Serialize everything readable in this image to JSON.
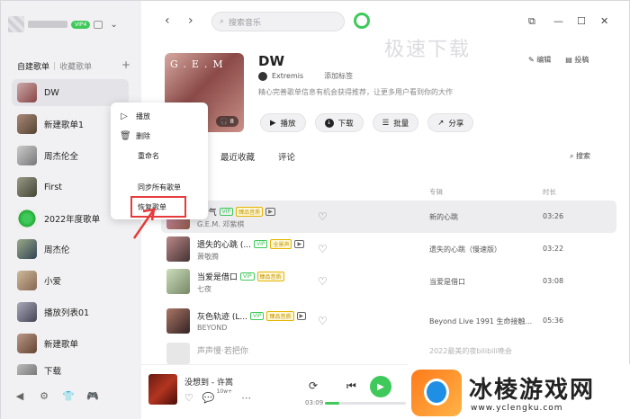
{
  "sidebar": {
    "vip_badge": "VIP4",
    "tab_created": "自建歌单",
    "tab_separator": "|",
    "tab_collected": "收藏歌单",
    "add_symbol": "+",
    "items": [
      {
        "label": "DW"
      },
      {
        "label": "新建歌单1"
      },
      {
        "label": "周杰伦全"
      },
      {
        "label": "First"
      },
      {
        "label": "2022年度歌单"
      },
      {
        "label": "周杰伦"
      },
      {
        "label": "小爱"
      },
      {
        "label": "播放列表01"
      },
      {
        "label": "新建歌单"
      },
      {
        "label": "下载"
      }
    ]
  },
  "topbar": {
    "search_placeholder": "搜索音乐"
  },
  "watermark": "极速下载",
  "playlist": {
    "title": "DW",
    "cover_text": "G.E.M",
    "cover_count": "8",
    "owner": "Extremis",
    "add_tag": "添加标签",
    "description": "精心完善歌单信息有机会获得推荐，让更多用户看到你的大作",
    "edit_label": "编辑",
    "submit_label": "投稿"
  },
  "actions": {
    "play": "播放",
    "download": "下载",
    "batch": "批量",
    "share": "分享"
  },
  "tabs": {
    "recent": "最近收藏",
    "comments": "评论",
    "search": "搜索"
  },
  "columns": {
    "album": "专辑",
    "duration": "时长"
  },
  "songs": [
    {
      "title": "...气",
      "artist": "G.E.M. 邓紫棋",
      "vip": "VIP",
      "quality": "臻品音质",
      "mv": "▶",
      "album": "新的心跳",
      "duration": "03:26"
    },
    {
      "title": "遗失的心跳 (...",
      "artist": "萧敬腾",
      "vip": "VIP",
      "quality": "全景声",
      "mv": "▶",
      "album": "遗失的心跳（慢速版）",
      "duration": "03:22"
    },
    {
      "title": "当爱是借口",
      "artist": "七夜",
      "vip": "VIP",
      "quality": "臻品音质",
      "mv": "",
      "album": "当爱是借口",
      "duration": "03:08"
    },
    {
      "title": "灰色轨迹 (L...",
      "artist": "BEYOND",
      "vip": "VIP",
      "quality": "臻品音质",
      "mv": "▶",
      "album": "Beyond Live 1991 生命接触...",
      "duration": "05:36"
    },
    {
      "title": "声声慢·若把你",
      "artist": "",
      "vip": "",
      "quality": "",
      "mv": "",
      "album": "2022最美的夜bilibili晚会",
      "duration": ""
    }
  ],
  "context_menu": {
    "play": "播放",
    "delete": "删除",
    "rename": "重命名",
    "sync": "同步所有歌单",
    "restore": "恢复歌单"
  },
  "player": {
    "now_playing": "没想到 - 许嵩",
    "comment_count": "10w+",
    "time": "03:09",
    "progress": 0.18
  },
  "ad": {
    "title": "冰棱游戏网",
    "url": "www.yclengku.com"
  },
  "colors": {
    "accent": "#3ec95a",
    "highlight_red": "#e53b3b"
  }
}
